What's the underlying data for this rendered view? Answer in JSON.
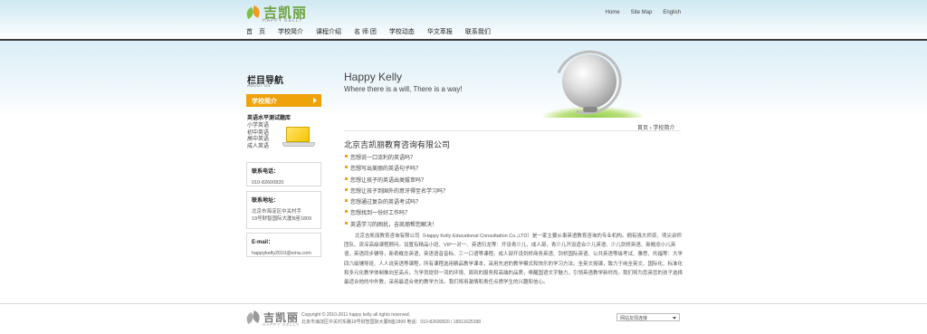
{
  "brand": {
    "name": "吉凯丽",
    "sub": "HAPPY KELLY"
  },
  "top_links": [
    "Home",
    "Site Map",
    "English"
  ],
  "nav": [
    "首　页",
    "学校简介",
    "课程介绍",
    "名 师 团",
    "学校动态",
    "华文萃报",
    "联系我们"
  ],
  "banner": {
    "title": "Happy Kelly",
    "subtitle": "Where there is a will, There is a way!"
  },
  "sidebar": {
    "title": "栏目导航",
    "subtitle": "ABOUT US",
    "active_item": "学校简介",
    "tests_title": "英语水平测试题库",
    "tests": [
      "小学英语",
      "初中英语",
      "高中英语",
      "成人英语"
    ],
    "phone_label": "联系电话：",
    "phone": "010-82600820",
    "address_label": "联系地址：",
    "address_lines": [
      "北京市海淀区中关村手",
      "19号财智国际大厦B座1809"
    ],
    "email_label": "E-mail：",
    "email": "happykelly2010@sina.com"
  },
  "breadcrumb": {
    "home": "首页",
    "current": "学校简介"
  },
  "main": {
    "heading": "北京吉凯丽教育咨询有限公司",
    "questions": [
      "您想说一口流利的英语吗？",
      "您想写出美丽的英语句子吗？",
      "您想让孩子的英语出类拔萃吗？",
      "您想让孩子到国外的意牙得至名学习吗？",
      "您想通过复杂的英语考试吗？",
      "您想找到一份好工作吗？",
      "英语学习的困扰，吉凯丽帮您解决！"
    ],
    "paragraph": "北京吉凯丽教育咨询有限公司（Happy Kelly Educational Consultation Co.,LTD）是一家主要从事英语教育咨询的专业机构。拥有强大师资、项尖讲师团队、资深高级课程顾问。设置有精品小班、VIP一对一、英语衍龙等：开设青少儿、成人部。青少儿开设适合少儿英语、少儿剑桥英语、新概念小儿英语，英语同步辅导，新奇概念英语，英语语音音标、三一口语等课程。成人部开设剑桥商务英语、剑桥国际英语、公共英语等级考试、雅思、托福等：大学四六级辅导班、人人说英语等课程，所有课程选用精品教学课本，采用先进的教学模式和快乐的学习方法。全英文授课，致力于纯全英文、国际化、标准化和多元化教学体制推向至高点，为学员提供一流的环境、周到的服务和高端的品质，唤醒国语文字魅力，引领英语教学新时尚。我们将为您英您的孩子选择最适合他的中外教，采用最适合他的教学方法。我们将用激情和责任点燃学生的兴趣和信心。"
  },
  "footer": {
    "copyright": "Copyright © 2010-2011 happy kelly all rights reserved.",
    "address": "北京市海淀区中关村东路19号财智国际大厦B座1809 电话：010-82600820 / 18911625398",
    "links_select": "网站友情连接"
  }
}
